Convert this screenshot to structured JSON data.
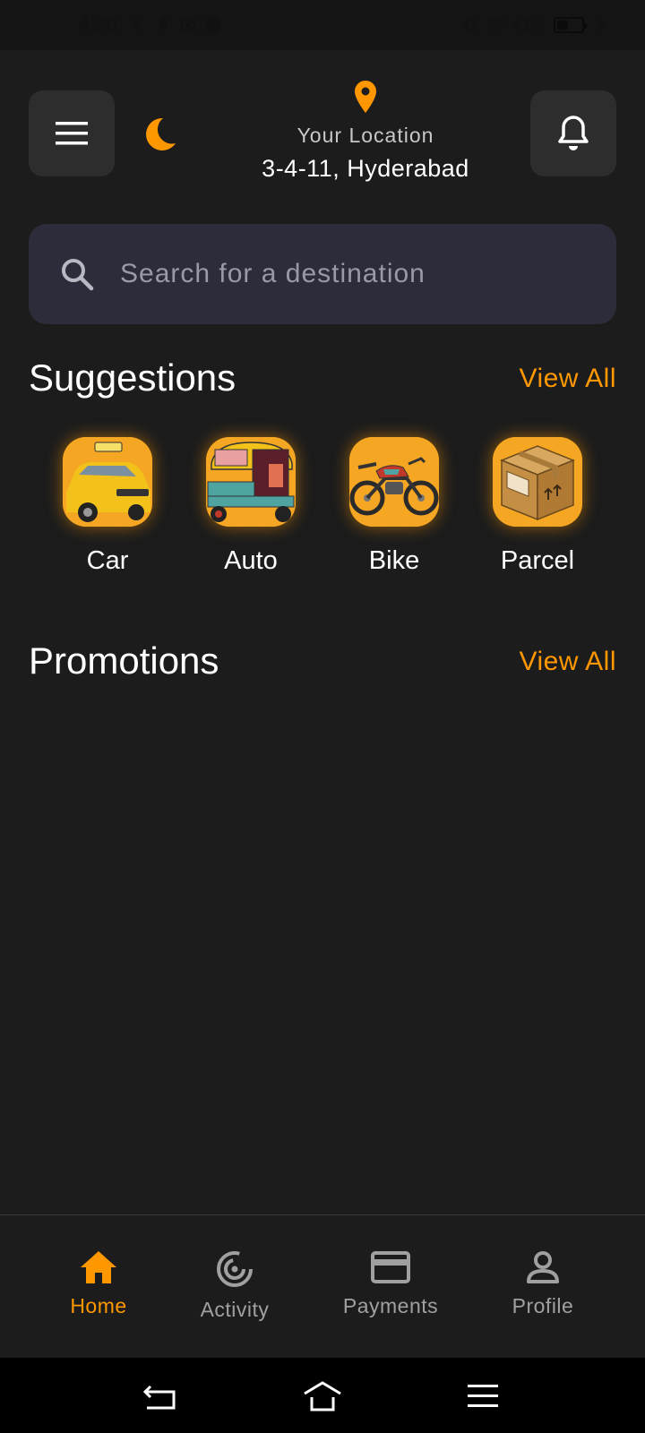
{
  "status_bar": {
    "time": "4:20",
    "battery": "41%"
  },
  "header": {
    "location_label": "Your Location",
    "address": "3-4-11, Hyderabad"
  },
  "search": {
    "placeholder": "Search for a destination"
  },
  "suggestions": {
    "title": "Suggestions",
    "view_all": "View All",
    "items": [
      {
        "label": "Car",
        "icon": "taxi-car-image"
      },
      {
        "label": "Auto",
        "icon": "auto-rickshaw-image"
      },
      {
        "label": "Bike",
        "icon": "motorbike-image"
      },
      {
        "label": "Parcel",
        "icon": "parcel-box-image"
      }
    ]
  },
  "promotions": {
    "title": "Promotions",
    "view_all": "View All"
  },
  "bottom_nav": {
    "items": [
      {
        "label": "Home",
        "icon": "home-icon",
        "active": true
      },
      {
        "label": "Activity",
        "icon": "activity-icon",
        "active": false
      },
      {
        "label": "Payments",
        "icon": "card-icon",
        "active": false
      },
      {
        "label": "Profile",
        "icon": "person-icon",
        "active": false
      }
    ]
  },
  "colors": {
    "background": "#1c1c1c",
    "accent": "#ff9800",
    "card": "#2d2d2d",
    "search_bg": "#2c2c3b",
    "inactive": "#a0a0a0"
  }
}
